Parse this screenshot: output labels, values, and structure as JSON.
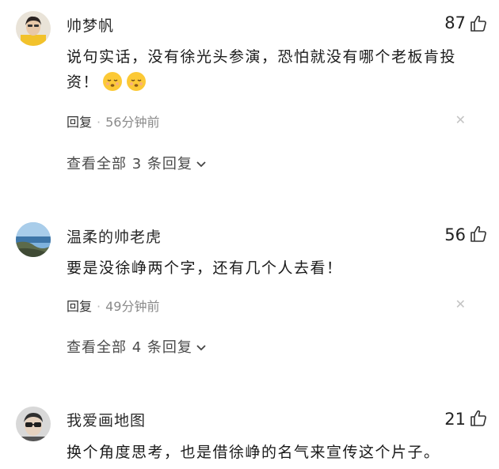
{
  "comments": [
    {
      "username": "帅梦帆",
      "likes": "87",
      "text": "说句实话，没有徐光头参演，恐怕就没有哪个老板肯投资！",
      "reply_label": "回复",
      "time": "56分钟前",
      "more_replies": "查看全部 3 条回复"
    },
    {
      "username": "温柔的帅老虎",
      "likes": "56",
      "text": "要是没徐峥两个字，还有几个人去看！",
      "reply_label": "回复",
      "time": "49分钟前",
      "more_replies": "查看全部 4 条回复"
    },
    {
      "username": "我爱画地图",
      "likes": "21",
      "text": "换个角度思考，也是借徐峥的名气来宣传这个片子。"
    }
  ],
  "icons": {
    "like": "thumbs-up-icon",
    "close": "close-icon",
    "chevron": "chevron-down-icon",
    "emoji": "sleeping-face-emoji"
  }
}
